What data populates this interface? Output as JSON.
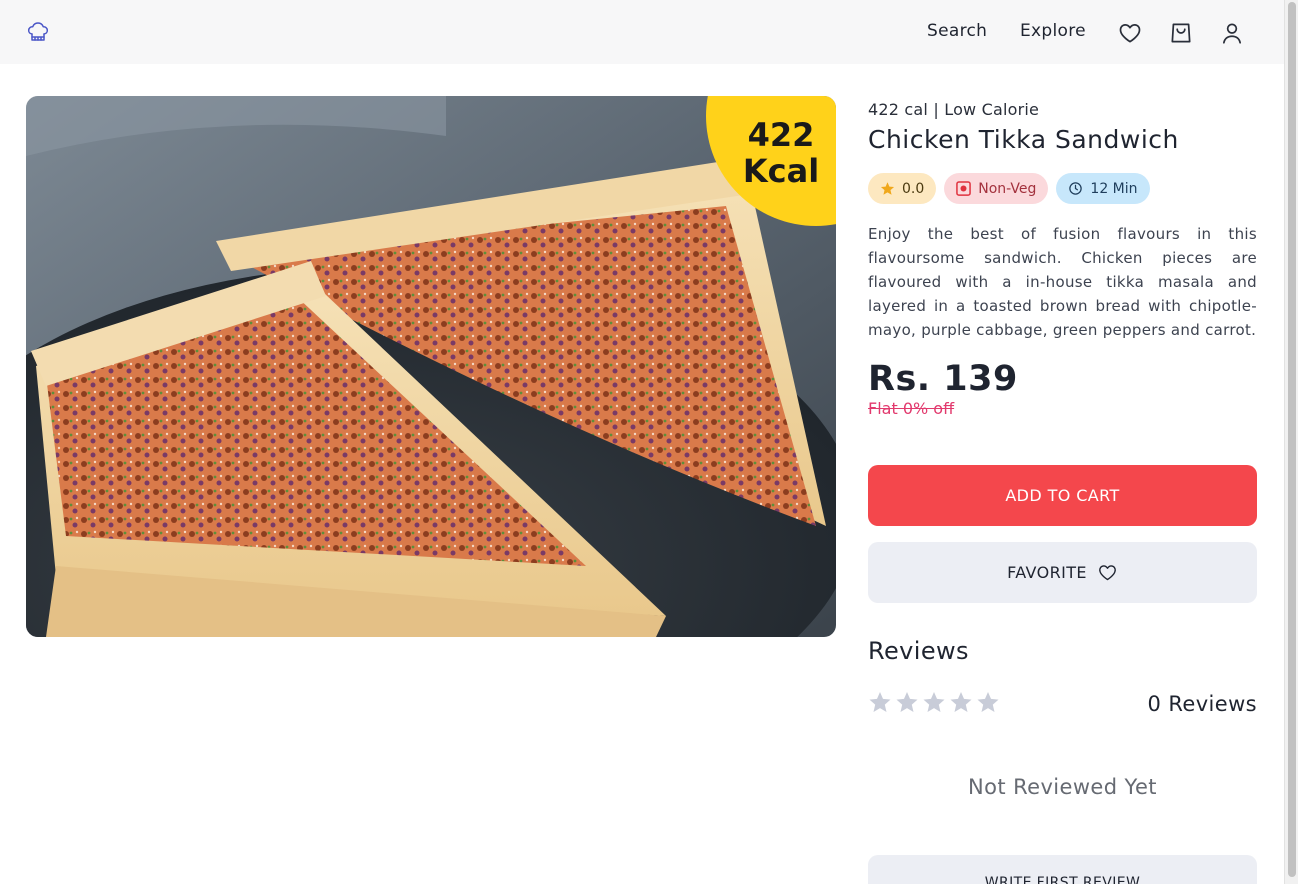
{
  "header": {
    "nav": [
      "Search",
      "Explore"
    ],
    "icons": [
      "chef-hat-logo-icon",
      "heart-icon",
      "shopping-bag-icon",
      "user-icon"
    ]
  },
  "product": {
    "image_badge": "422 Kcal",
    "meta": "422 cal | Low Calorie",
    "name": "Chicken Tikka Sandwich",
    "rating": "0.0",
    "diet": "Non-Veg",
    "time": "12 Min",
    "description": "Enjoy the best of fusion flavours in this flavoursome sandwich. Chicken pieces are flavoured with a in-house tikka masala and layered in a toasted brown bread with chipotle-mayo, purple cabbage, green peppers and carrot.",
    "price": "Rs. 139",
    "discount": "Flat 0% off"
  },
  "actions": {
    "add_to_cart": "ADD TO CART",
    "favorite": "FAVORITE",
    "write_review": "WRITE FIRST REVIEW"
  },
  "reviews": {
    "title": "Reviews",
    "stars_filled": 0,
    "stars_total": 5,
    "count_label": "0 Reviews",
    "empty_state": "Not Reviewed Yet"
  },
  "colors": {
    "accent": "#f4474c",
    "discount": "#e23a6e",
    "badge": "#ffd21a"
  }
}
